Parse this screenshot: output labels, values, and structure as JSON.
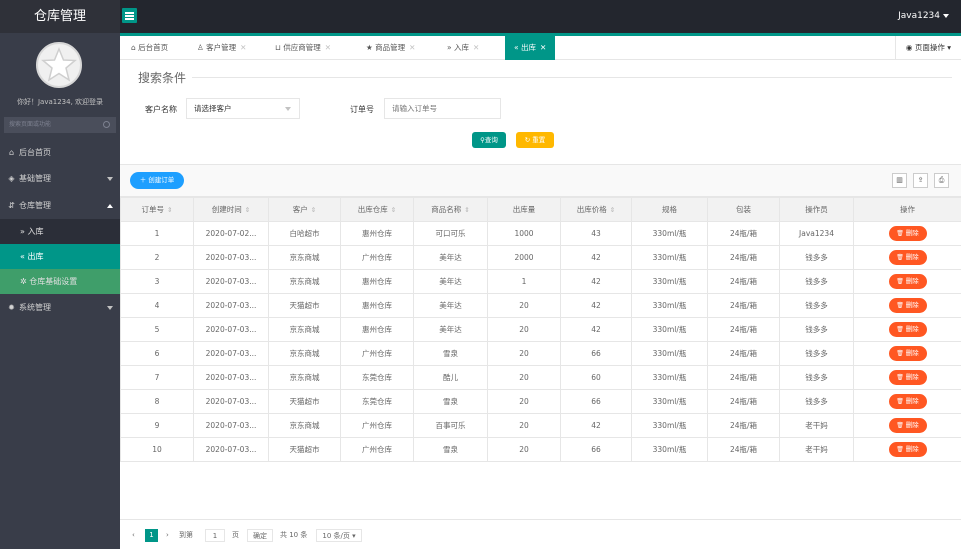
{
  "app": {
    "title": "仓库管理",
    "user": "Java1234"
  },
  "sidebar": {
    "welcome": "你好！Java1234, 欢迎登录",
    "search_placeholder": "搜索页面或功能",
    "items": [
      {
        "icon": "home-icon",
        "label": "后台首页"
      },
      {
        "icon": "cube-icon",
        "label": "基础管理"
      },
      {
        "icon": "warehouse-icon",
        "label": "仓库管理"
      },
      {
        "icon": "gear-icon",
        "label": "系统管理"
      }
    ],
    "sub_items": [
      {
        "icon": "double-right-icon",
        "label": "入库"
      },
      {
        "icon": "double-left-icon",
        "label": "出库"
      },
      {
        "icon": "settings-icon",
        "label": "仓库基础设置"
      }
    ]
  },
  "tabs": [
    {
      "icon": "home-icon",
      "label": "后台首页",
      "closable": false
    },
    {
      "icon": "user-icon",
      "label": "客户管理",
      "closable": true
    },
    {
      "icon": "cart-icon",
      "label": "供应商管理",
      "closable": true
    },
    {
      "icon": "star-icon",
      "label": "商品管理",
      "closable": true
    },
    {
      "icon": "double-right-icon",
      "label": "入库",
      "closable": true
    },
    {
      "icon": "double-left-icon",
      "label": "出库",
      "closable": true
    }
  ],
  "page_ops_label": "页面操作",
  "search": {
    "title": "搜索条件",
    "customer_label": "客户名称",
    "customer_value": "请选择客户",
    "order_label": "订单号",
    "order_placeholder": "请输入订单号",
    "query_label": "查询",
    "reset_label": "重置"
  },
  "toolbar": {
    "create_label": "创建订单"
  },
  "table": {
    "headers": [
      "订单号",
      "创建时间",
      "客户",
      "出库仓库",
      "商品名称",
      "出库量",
      "出库价格",
      "规格",
      "包装",
      "操作员",
      "操作"
    ],
    "sortable": [
      true,
      true,
      true,
      true,
      true,
      false,
      true,
      false,
      false,
      false,
      false
    ],
    "delete_label": "删除",
    "rows": [
      [
        "1",
        "2020-07-02...",
        "白哈超市",
        "惠州仓库",
        "可口可乐",
        "1000",
        "43",
        "330ml/瓶",
        "24瓶/箱",
        "Java1234"
      ],
      [
        "2",
        "2020-07-03...",
        "京东商城",
        "广州仓库",
        "美年达",
        "2000",
        "42",
        "330ml/瓶",
        "24瓶/箱",
        "钱多多"
      ],
      [
        "3",
        "2020-07-03...",
        "京东商城",
        "惠州仓库",
        "美年达",
        "1",
        "42",
        "330ml/瓶",
        "24瓶/箱",
        "钱多多"
      ],
      [
        "4",
        "2020-07-03...",
        "天猫超市",
        "惠州仓库",
        "美年达",
        "20",
        "42",
        "330ml/瓶",
        "24瓶/箱",
        "钱多多"
      ],
      [
        "5",
        "2020-07-03...",
        "京东商城",
        "惠州仓库",
        "美年达",
        "20",
        "42",
        "330ml/瓶",
        "24瓶/箱",
        "钱多多"
      ],
      [
        "6",
        "2020-07-03...",
        "京东商城",
        "广州仓库",
        "雪泉",
        "20",
        "66",
        "330ml/瓶",
        "24瓶/箱",
        "钱多多"
      ],
      [
        "7",
        "2020-07-03...",
        "京东商城",
        "东莞仓库",
        "酷儿",
        "20",
        "60",
        "330ml/瓶",
        "24瓶/箱",
        "钱多多"
      ],
      [
        "8",
        "2020-07-03...",
        "天猫超市",
        "东莞仓库",
        "雪泉",
        "20",
        "66",
        "330ml/瓶",
        "24瓶/箱",
        "钱多多"
      ],
      [
        "9",
        "2020-07-03...",
        "京东商城",
        "广州仓库",
        "百事可乐",
        "20",
        "42",
        "330ml/瓶",
        "24瓶/箱",
        "老干妈"
      ],
      [
        "10",
        "2020-07-03...",
        "天猫超市",
        "广州仓库",
        "雪泉",
        "20",
        "66",
        "330ml/瓶",
        "24瓶/箱",
        "老干妈"
      ]
    ]
  },
  "pager": {
    "current": "1",
    "goto_label": "到第",
    "goto_value": "1",
    "page_label": "页",
    "confirm_label": "确定",
    "total_label": "共 10 条",
    "per_page_label": "10 条/页"
  },
  "colors": {
    "accent": "#009688",
    "danger": "#ff5722",
    "warn": "#ffb800",
    "primary": "#1e9fff",
    "topbar": "#23262e",
    "sidebar": "#393d49"
  }
}
